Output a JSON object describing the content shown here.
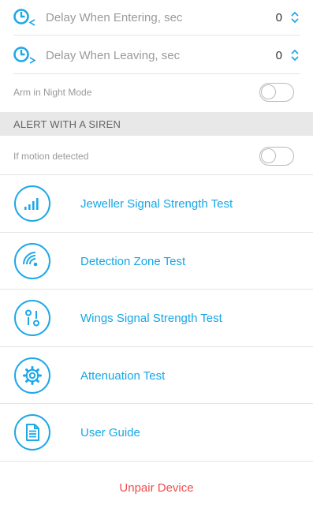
{
  "delays": [
    {
      "label": "Delay When Entering, sec",
      "value": "0",
      "icon": "clock-enter-icon"
    },
    {
      "label": "Delay When Leaving, sec",
      "value": "0",
      "icon": "clock-leave-icon"
    }
  ],
  "night_mode": {
    "label": "Arm in Night Mode",
    "on": false
  },
  "siren_section": {
    "title": "ALERT WITH A SIREN"
  },
  "motion_siren": {
    "label": "If motion detected",
    "on": false
  },
  "tests": [
    {
      "label": "Jeweller Signal Strength Test",
      "icon": "signal-strength-icon"
    },
    {
      "label": "Detection Zone Test",
      "icon": "detection-zone-icon"
    },
    {
      "label": "Wings Signal Strength Test",
      "icon": "wings-signal-icon"
    },
    {
      "label": "Attenuation Test",
      "icon": "gear-icon"
    },
    {
      "label": "User Guide",
      "icon": "document-icon"
    }
  ],
  "unpair": {
    "label": "Unpair Device"
  },
  "colors": {
    "accent": "#1ea8e8",
    "danger": "#ef4d4d"
  }
}
